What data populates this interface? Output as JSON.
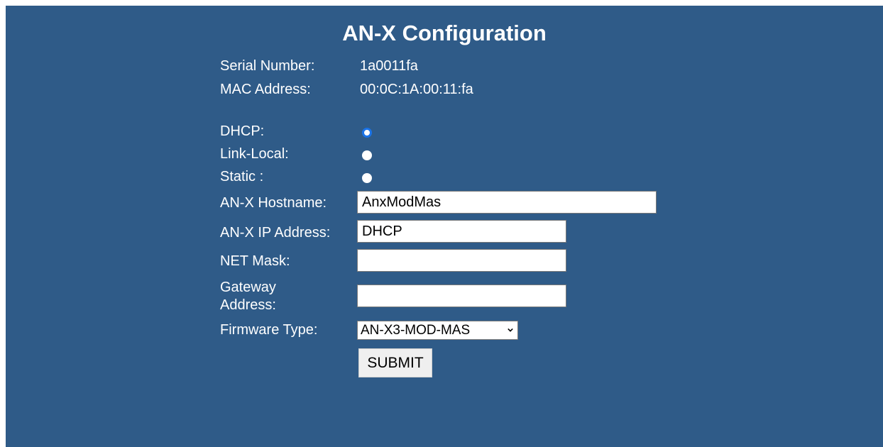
{
  "page": {
    "title": "AN-X Configuration"
  },
  "info": {
    "serial_label": "Serial Number:",
    "serial_value": "1a0011fa",
    "mac_label": "MAC Address:",
    "mac_value": "00:0C:1A:00:11:fa"
  },
  "ip_mode": {
    "options": [
      {
        "label": "DHCP:",
        "checked": true
      },
      {
        "label": "Link-Local:",
        "checked": false
      },
      {
        "label": "Static :",
        "checked": false
      }
    ]
  },
  "form": {
    "hostname_label": "AN-X Hostname:",
    "hostname_value": "AnxModMas",
    "ip_label": "AN-X IP Address:",
    "ip_value": "DHCP",
    "netmask_label": "NET Mask:",
    "netmask_value": "",
    "gateway_label_line1": "Gateway",
    "gateway_label_line2": "Address:",
    "gateway_value": "",
    "firmware_label": "Firmware Type:",
    "firmware_selected": "AN-X3-MOD-MAS",
    "submit_label": "SUBMIT"
  },
  "colors": {
    "background": "#2f5b88",
    "radio_accent": "#1a73e8"
  }
}
